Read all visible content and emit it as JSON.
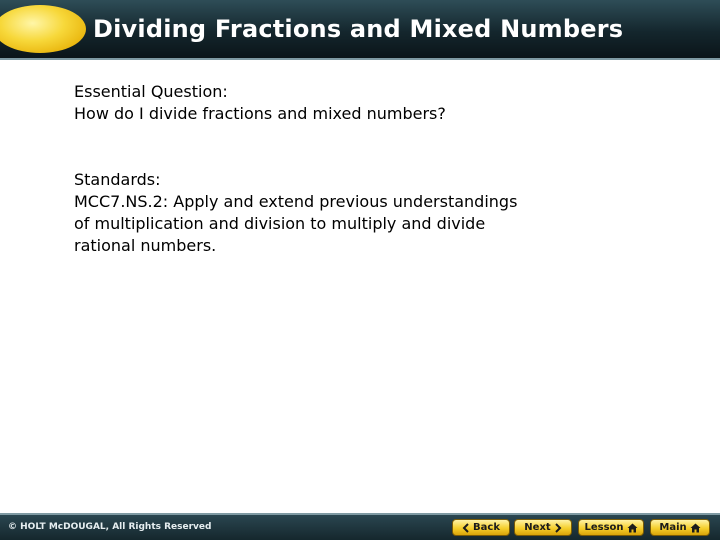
{
  "header": {
    "title": "Dividing Fractions and Mixed Numbers"
  },
  "content": {
    "question_heading": "Essential Question:",
    "question_text": "How do I divide fractions and mixed numbers?",
    "standards_heading": "Standards:",
    "standards_lines": [
      "MCC7.NS.2: Apply and extend previous understandings",
      "of multiplication and division to multiply and divide",
      "rational numbers."
    ]
  },
  "footer": {
    "copyright": "© HOLT McDOUGAL, All Rights Reserved",
    "buttons": {
      "back": "Back",
      "next": "Next",
      "lesson": "Lesson",
      "main": "Main"
    }
  },
  "colors": {
    "header_dark": "#14262d",
    "accent_yellow": "#f5cf2c",
    "text": "#000000"
  },
  "icons": {
    "back": "chevron-left-icon",
    "next": "chevron-right-icon",
    "lesson": "home-icon",
    "main": "home-icon"
  }
}
